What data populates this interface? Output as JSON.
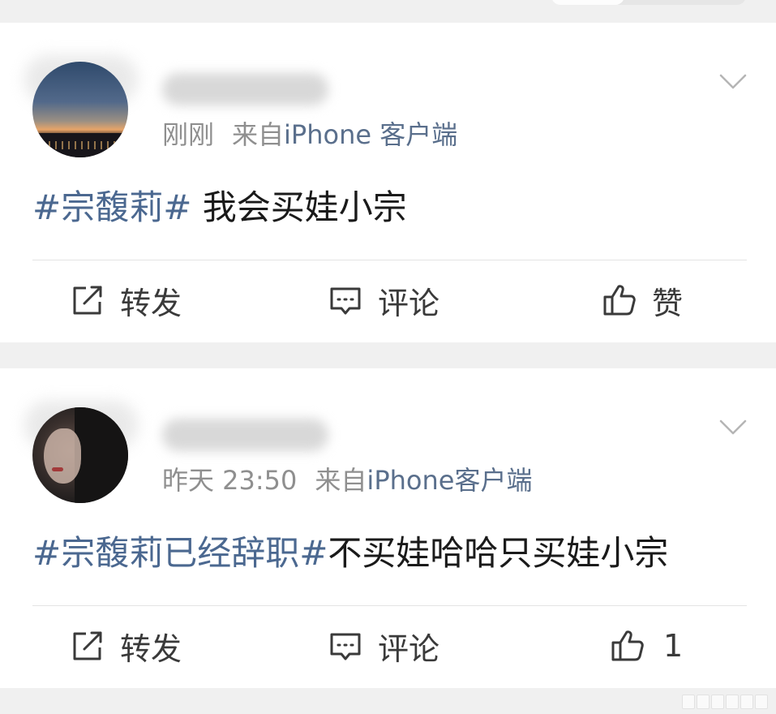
{
  "posts": [
    {
      "time": "刚刚",
      "from_prefix": "来自",
      "client": "iPhone 客户端",
      "topic": "#宗馥莉#",
      "text": " 我会买娃小宗",
      "actions": {
        "repost": "转发",
        "comment": "评论",
        "like": "赞"
      }
    },
    {
      "time": "昨天 23:50",
      "from_prefix": "来自",
      "client": "iPhone客户端",
      "topic": "#宗馥莉已经辞职#",
      "text": "不买娃哈哈只买娃小宗",
      "actions": {
        "repost": "转发",
        "comment": "评论",
        "like": "1"
      }
    }
  ],
  "colors": {
    "topic": "#4b6890",
    "client": "#5a6f8c",
    "meta": "#8f8f8f",
    "background": "#f0f0f0",
    "card": "#ffffff"
  },
  "icons": [
    "chevron-down-icon",
    "repost-icon",
    "comment-icon",
    "thumbs-up-icon"
  ]
}
